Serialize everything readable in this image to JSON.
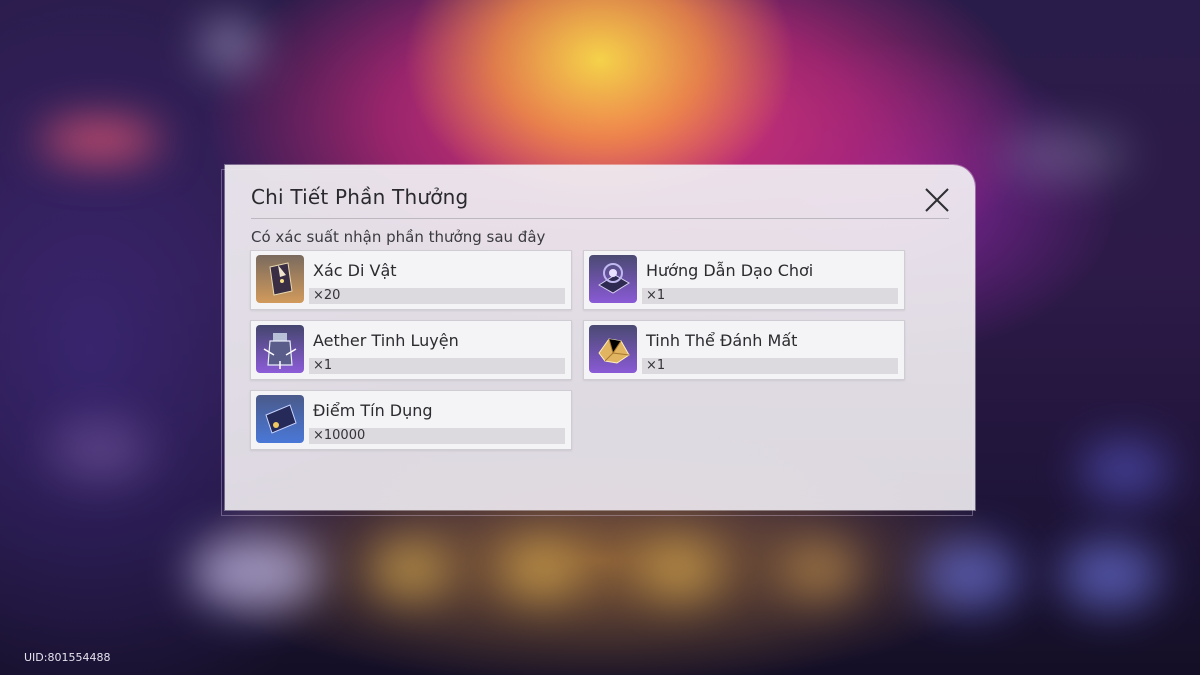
{
  "dialog": {
    "title": "Chi Tiết Phần Thưởng",
    "subtitle": "Có xác suất nhận phần thưởng sau đây",
    "close_icon": "close-x-icon",
    "rewards": [
      {
        "name": "Xác Di Vật",
        "quantity": "×20",
        "icon": "relic-remains-icon",
        "rarity_color": "#c8935a"
      },
      {
        "name": "Hướng Dẫn Dạo Chơi",
        "quantity": "×1",
        "icon": "travel-guide-book-icon",
        "rarity_color": "#7a55c8"
      },
      {
        "name": "Aether Tinh Luyện",
        "quantity": "×1",
        "icon": "refined-aether-icon",
        "rarity_color": "#7a55c8"
      },
      {
        "name": "Tinh Thể Đánh Mất",
        "quantity": "×1",
        "icon": "lost-crystal-icon",
        "rarity_color": "#7a55c8"
      },
      {
        "name": "Điểm Tín Dụng",
        "quantity": "×10000",
        "icon": "credit-card-icon",
        "rarity_color": "#4a6ad0"
      }
    ]
  },
  "footer": {
    "uid": "UID:801554488"
  }
}
